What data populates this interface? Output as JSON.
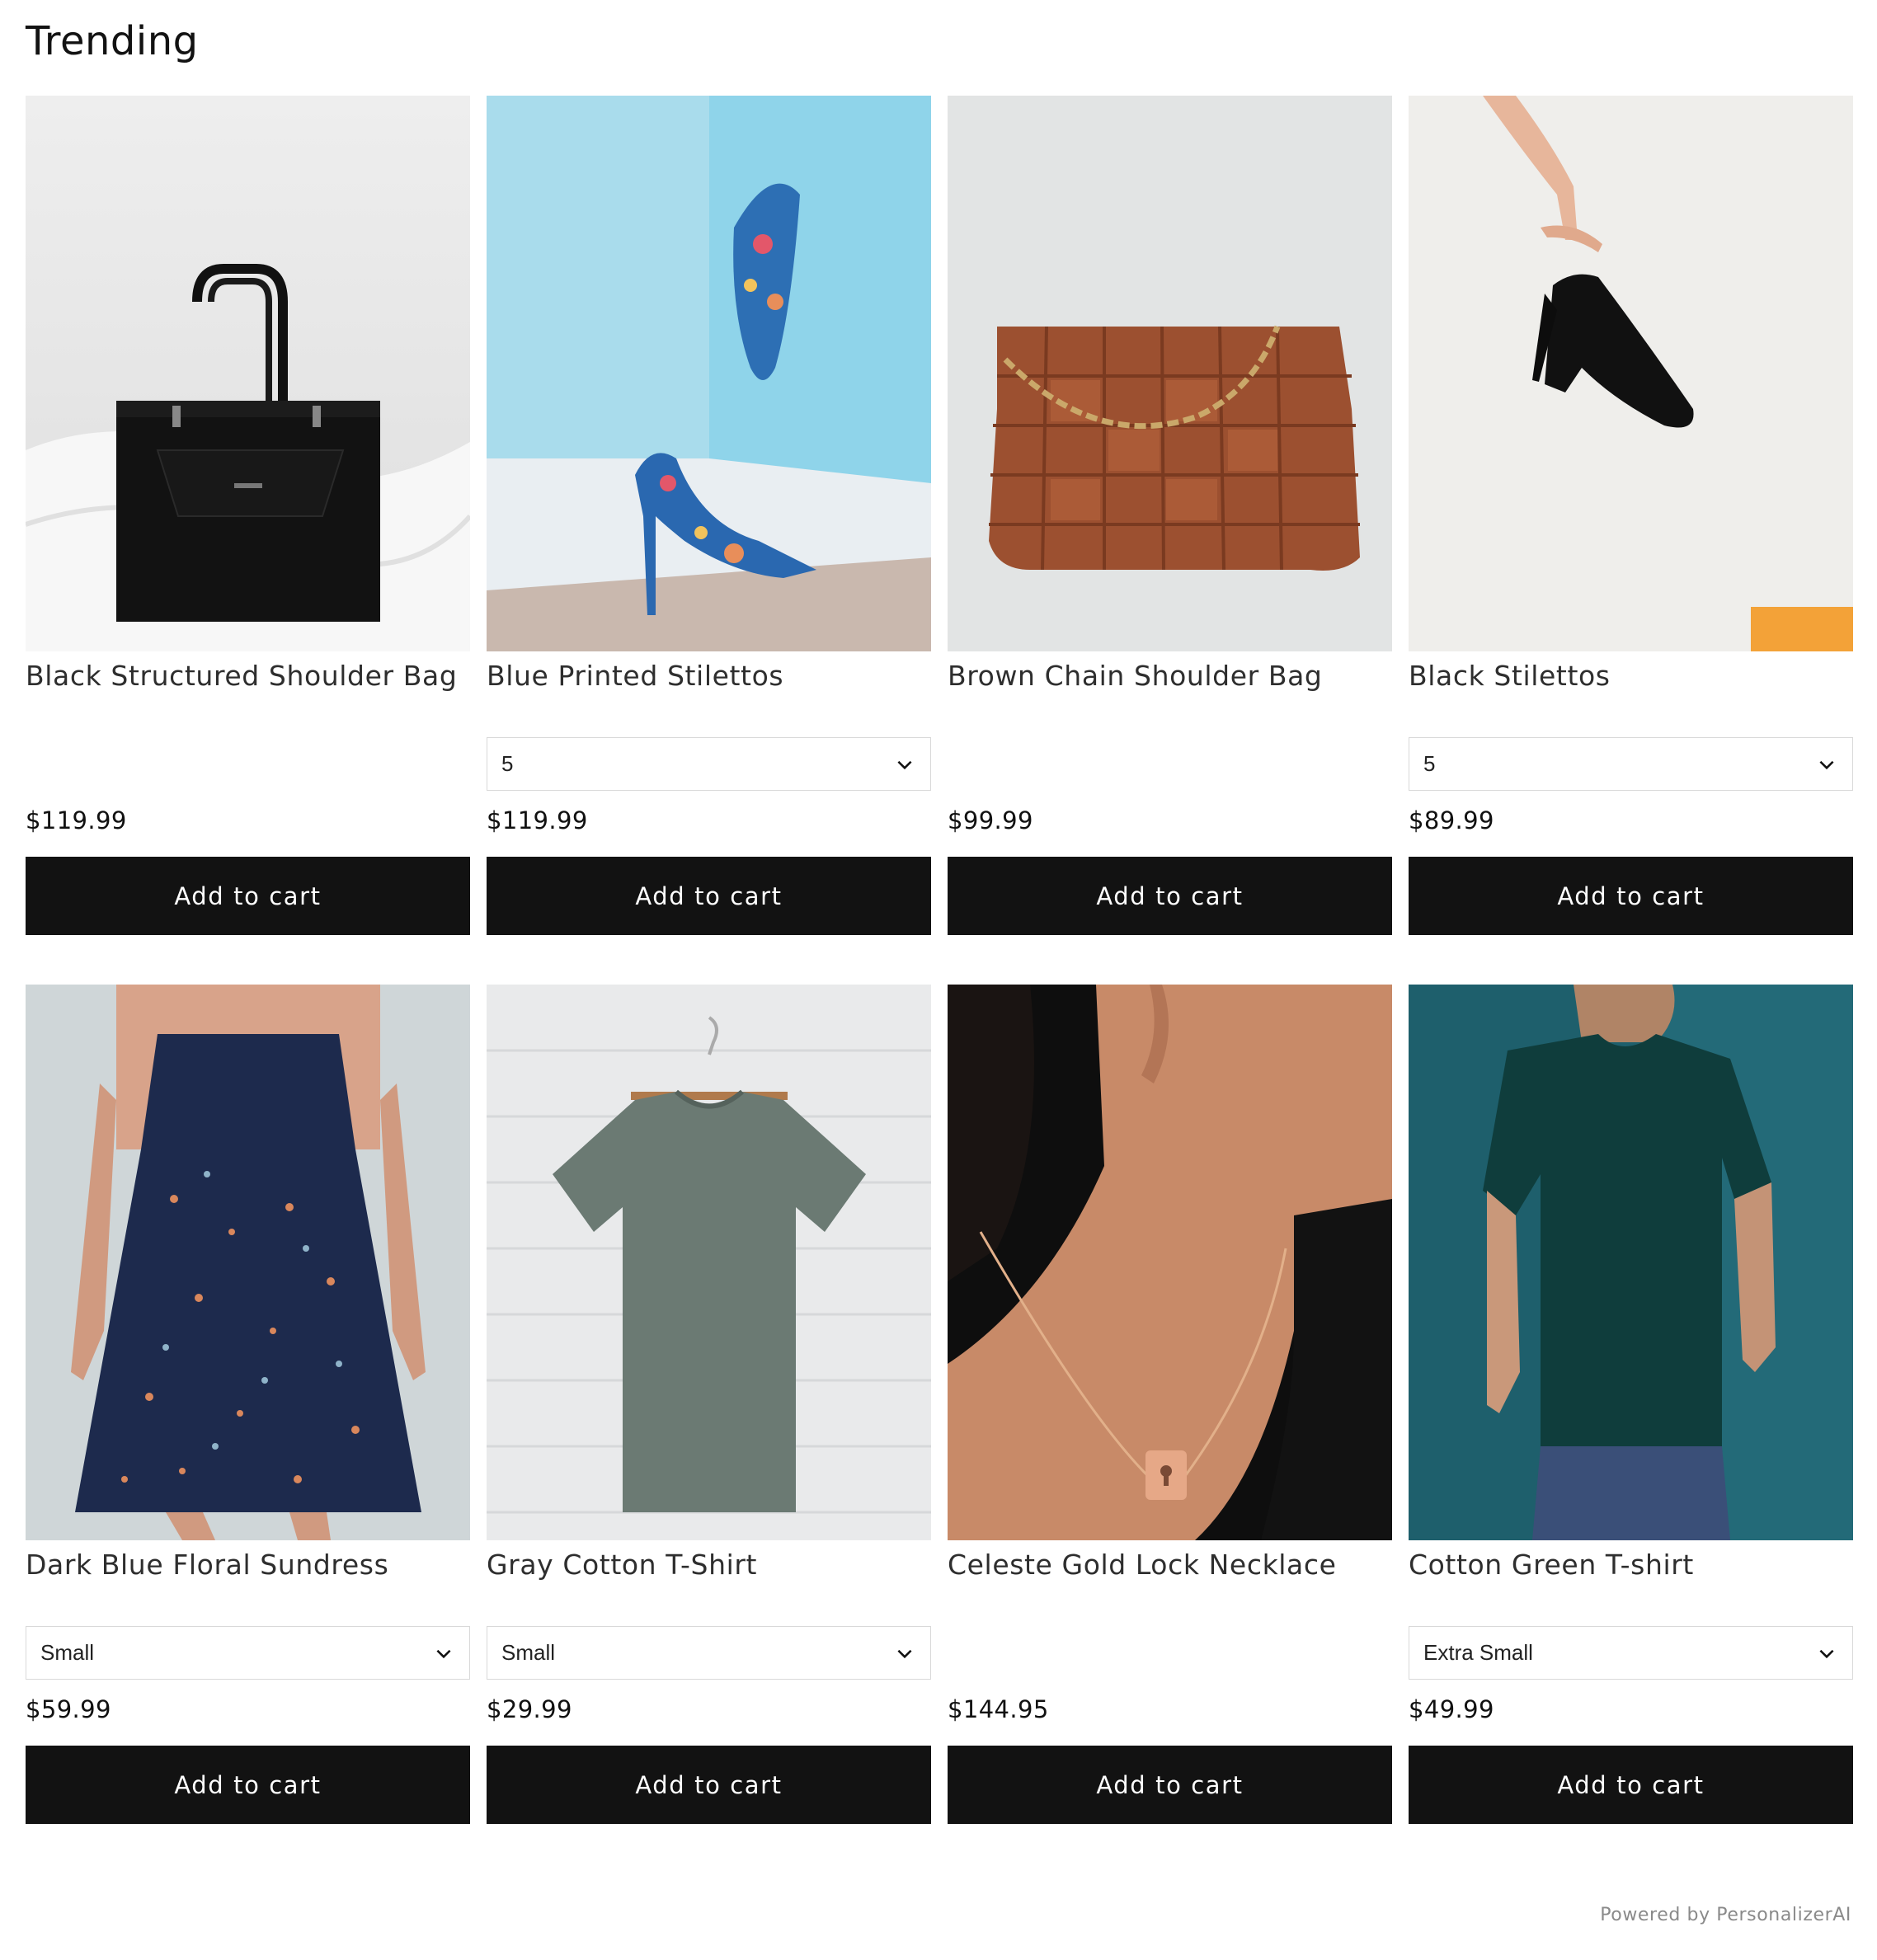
{
  "section": {
    "title": "Trending"
  },
  "products": [
    {
      "name": "Black Structured Shoulder Bag",
      "price": "$119.99",
      "cta": "Add to cart"
    },
    {
      "name": "Blue Printed Stilettos",
      "variant": "5",
      "price": "$119.99",
      "cta": "Add to cart"
    },
    {
      "name": "Brown Chain Shoulder Bag",
      "price": "$99.99",
      "cta": "Add to cart"
    },
    {
      "name": "Black Stilettos",
      "variant": "5",
      "price": "$89.99",
      "cta": "Add to cart"
    },
    {
      "name": "Dark Blue Floral Sundress",
      "variant": "Small",
      "price": "$59.99",
      "cta": "Add to cart"
    },
    {
      "name": "Gray Cotton T-Shirt",
      "variant": "Small",
      "price": "$29.99",
      "cta": "Add to cart"
    },
    {
      "name": "Celeste Gold Lock Necklace",
      "price": "$144.95",
      "cta": "Add to cart"
    },
    {
      "name": "Cotton Green T-shirt",
      "variant": "Extra Small",
      "price": "$49.99",
      "cta": "Add to cart"
    }
  ],
  "footer": {
    "powered_by": "Powered by PersonalizerAI"
  },
  "colors": {
    "button_bg": "#121212",
    "button_text": "#ffffff",
    "select_border": "#d9d9d9"
  }
}
